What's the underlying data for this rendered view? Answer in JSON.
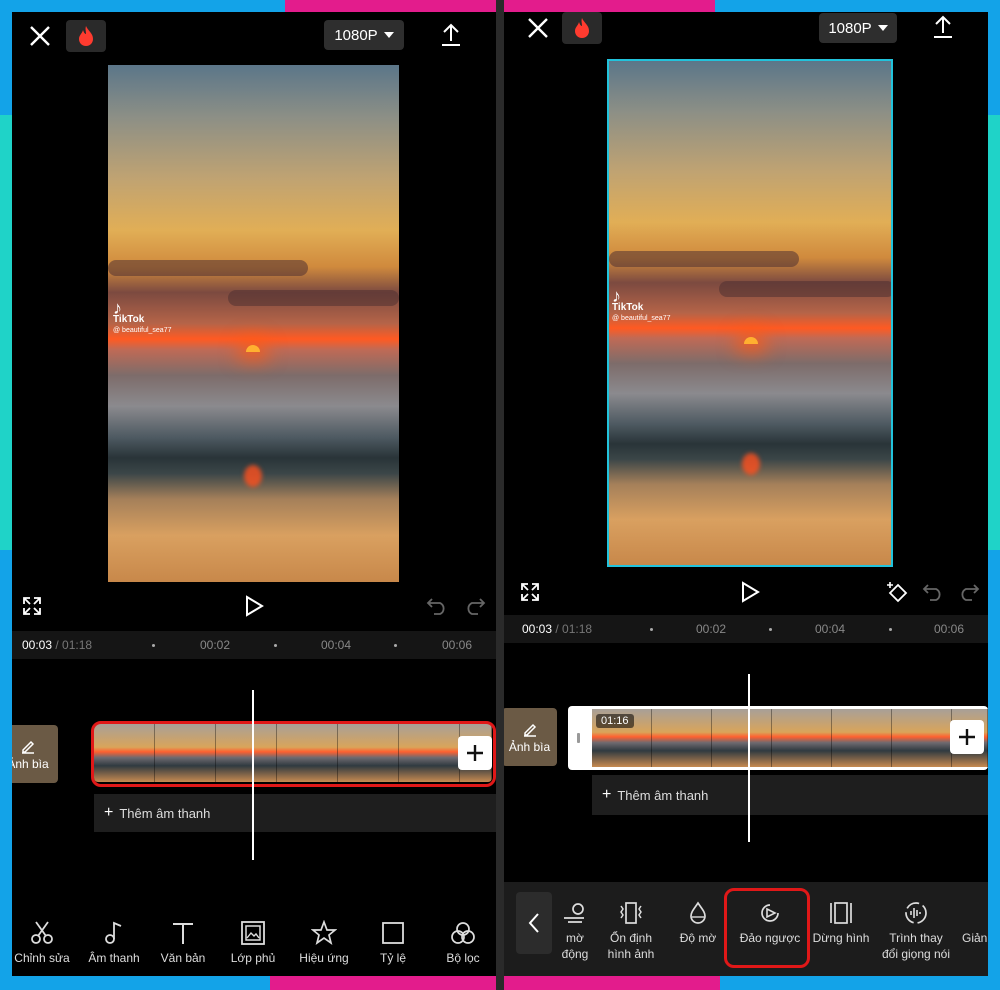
{
  "colors": {
    "frame_blue": "#13a3e8",
    "frame_pink": "#e31c8c",
    "frame_teal": "#1fd3c8",
    "highlight_red": "#e01818",
    "selection_cyan": "#22c3dc"
  },
  "left": {
    "topbar": {
      "resolution": "1080P"
    },
    "watermark": {
      "brand": "TikTok",
      "user": "@ beautiful_sea77"
    },
    "timebar": {
      "current": "00:03",
      "total": "/ 01:18",
      "ticks": [
        "00:02",
        "00:04",
        "00:06"
      ]
    },
    "cover_label": "Ảnh bìa",
    "add_audio": "Thêm âm thanh",
    "toolbar": [
      {
        "icon": "scissors-icon",
        "label": "Chỉnh sửa"
      },
      {
        "icon": "music-note-icon",
        "label": "Âm thanh"
      },
      {
        "icon": "text-icon",
        "label": "Văn bản"
      },
      {
        "icon": "overlay-icon",
        "label": "Lớp phủ"
      },
      {
        "icon": "effects-star-icon",
        "label": "Hiệu ứng"
      },
      {
        "icon": "ratio-square-icon",
        "label": "Tỷ lệ"
      },
      {
        "icon": "filter-icon",
        "label": "Bộ lọc"
      }
    ]
  },
  "right": {
    "topbar": {
      "resolution": "1080P"
    },
    "watermark": {
      "brand": "TikTok",
      "user": "@ beautiful_sea77"
    },
    "timebar": {
      "current": "00:03",
      "total": "/ 01:18",
      "ticks": [
        "00:02",
        "00:04",
        "00:06"
      ]
    },
    "cover_label": "Ảnh bìa",
    "clip_duration": "01:16",
    "add_audio": "Thêm âm thanh",
    "toolbar": [
      {
        "icon": "motion-blur-icon",
        "label": "... mờ\n... động"
      },
      {
        "icon": "stabilize-icon",
        "label": "Ổn định\nhình ảnh"
      },
      {
        "icon": "opacity-drop-icon",
        "label": "Độ mờ"
      },
      {
        "icon": "reverse-play-icon",
        "label": "Đảo ngược"
      },
      {
        "icon": "freeze-frame-icon",
        "label": "Dừng hình"
      },
      {
        "icon": "voice-changer-icon",
        "label": "Trình thay\nđổi giọng nói"
      },
      {
        "icon": "more-icon",
        "label": "Giản"
      }
    ]
  }
}
